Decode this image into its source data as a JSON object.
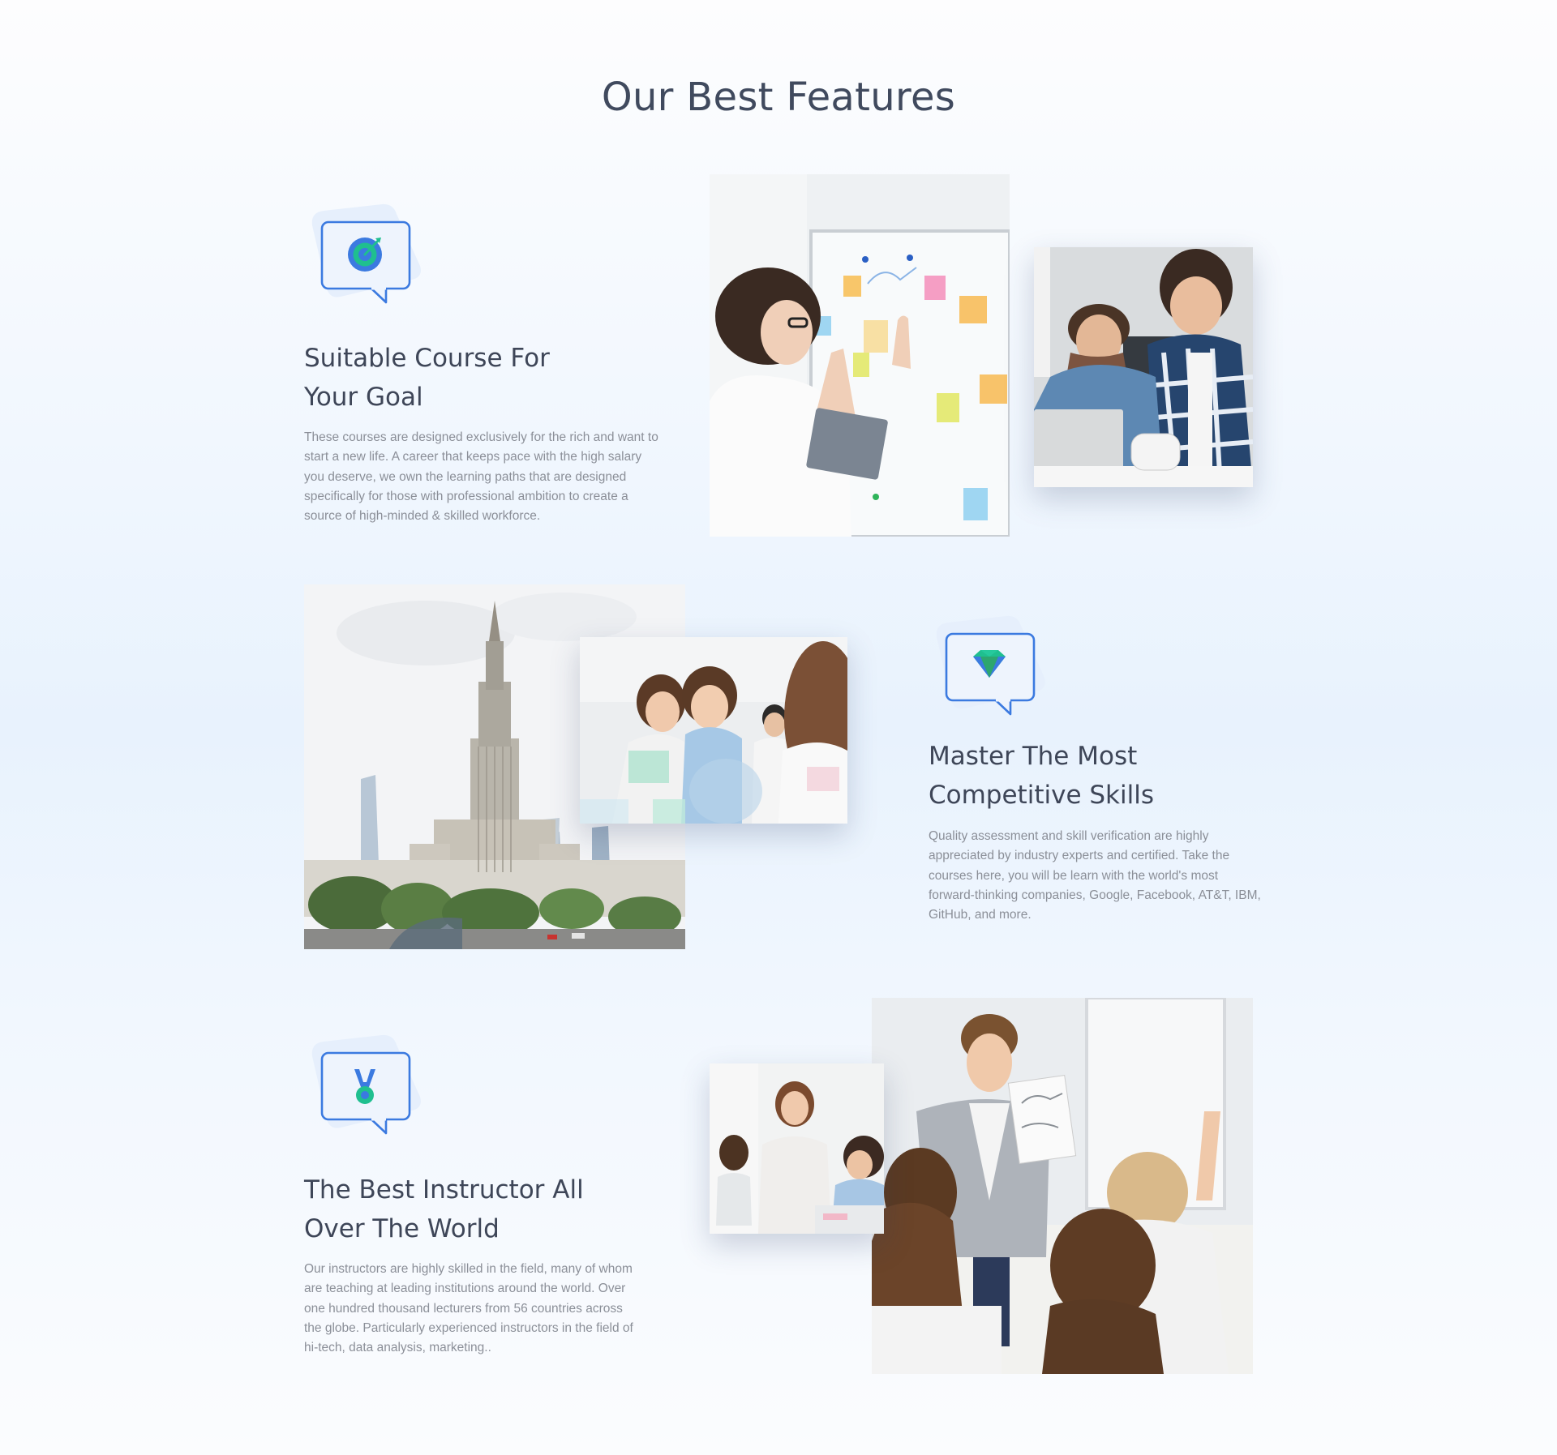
{
  "section": {
    "title": "Our Best Features"
  },
  "features": [
    {
      "icon": "target-icon",
      "heading_line1": "Suitable Course For",
      "heading_line2": "Your Goal",
      "text": "These courses are designed exclusively for the rich and want to start a new life. A career that keeps pace with the high salary you deserve, we own the learning paths that are designed specifically for those with professional ambition to create a source of high-minded & skilled workforce."
    },
    {
      "icon": "diamond-icon",
      "heading_line1": "Master The Most",
      "heading_line2": "Competitive Skills",
      "text": "Quality assessment and skill verification are highly appreciated by industry experts and certified. Take the courses here, you will be learn with the world's most forward-thinking companies, Google, Facebook, AT&T, IBM, GitHub, and more."
    },
    {
      "icon": "medal-icon",
      "heading_line1": "The Best Instructor All",
      "heading_line2": "Over The World",
      "text": "Our instructors are highly skilled in the field, many of whom are teaching at leading institutions around the world. Over one hundred thousand lecturers from 56 countries across the globe. Particularly experienced instructors in the field of hi-tech, data analysis, marketing.."
    }
  ],
  "colors": {
    "accent_blue": "#3b7ae0",
    "accent_green": "#1fbf8f",
    "badge_fill": "#e6effc",
    "heading": "#3e4658",
    "body_text": "#8b8f98"
  }
}
